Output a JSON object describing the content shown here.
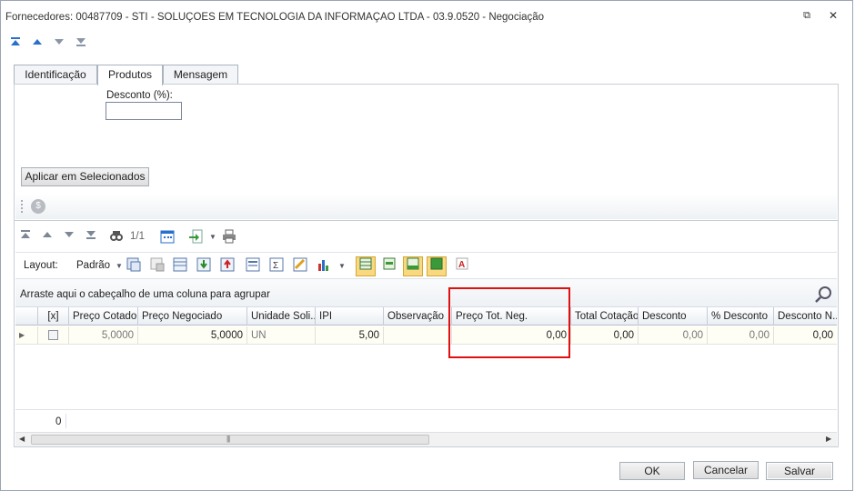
{
  "window": {
    "title": "Fornecedores: 00487709 - STI - SOLUÇOES EM TECNOLOGIA DA INFORMAÇAO LTDA - 03.9.0520 - Negociação",
    "restore_glyph": "⧉",
    "close_glyph": "✕"
  },
  "tabs": [
    {
      "label": "Identificação"
    },
    {
      "label": "Produtos"
    },
    {
      "label": "Mensagem"
    }
  ],
  "form": {
    "discount_label": "Desconto (%):",
    "discount_value": "",
    "apply_button": "Aplicar em Selecionados"
  },
  "grid_toolbar": {
    "page_indicator": "1/1",
    "layout_label": "Layout:",
    "layout_value": "Padrão"
  },
  "group_hint": "Arraste aqui o cabeçalho de uma coluna para agrupar",
  "columns": [
    "[x]",
    "Preço Cotado",
    "Preço Negociado",
    "Unidade Soli...",
    "IPI",
    "Observação",
    "Preço Tot. Neg.",
    "Total Cotação",
    "Desconto",
    "% Desconto",
    "Desconto N..."
  ],
  "rows": [
    {
      "checked": false,
      "preco_cotado": "5,0000",
      "preco_negociado": "5,0000",
      "unidade": "UN",
      "ipi": "5,00",
      "observacao": "",
      "preco_tot_neg": "0,00",
      "total_cotacao": "0,00",
      "desconto": "0,00",
      "pct_desconto": "0,00",
      "desconto_n": "0,00"
    }
  ],
  "footer": {
    "count": "0"
  },
  "buttons": {
    "ok": "OK",
    "cancel": "Cancelar",
    "save": "Salvar"
  },
  "colors": {
    "highlight": "#e01010",
    "accent": "#2a6fc9"
  }
}
